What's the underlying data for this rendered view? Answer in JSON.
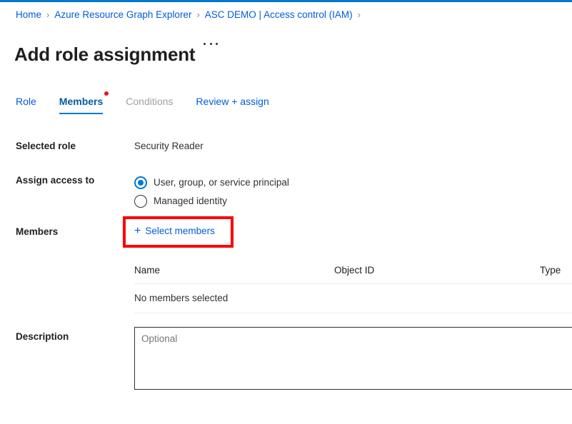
{
  "theme": {
    "accent": "#0078d4",
    "link": "#015cda",
    "highlight_red": "#fe0000",
    "dot_red": "#e81123",
    "disabled_text": "#a19f9d"
  },
  "top_accent_bar": {
    "color": "#0078d4"
  },
  "breadcrumb": {
    "items": [
      {
        "label": "Home"
      },
      {
        "label": "Azure Resource Graph Explorer"
      },
      {
        "label": "ASC DEMO | Access control (IAM)"
      }
    ],
    "separator": "›"
  },
  "header": {
    "title": "Add role assignment",
    "more_menu": "more-commands-ellipsis"
  },
  "tabs": [
    {
      "label": "Role",
      "state": "enabled"
    },
    {
      "label": "Members",
      "state": "active",
      "has_required_dot": true
    },
    {
      "label": "Conditions",
      "state": "disabled"
    },
    {
      "label": "Review + assign",
      "state": "enabled"
    }
  ],
  "form": {
    "selected_role": {
      "label": "Selected role",
      "value": "Security Reader"
    },
    "assign_access_to": {
      "label": "Assign access to",
      "options": [
        {
          "label": "User, group, or service principal",
          "checked": true
        },
        {
          "label": "Managed identity",
          "checked": false
        }
      ]
    },
    "members": {
      "label": "Members",
      "select_button": "Select members",
      "plus_icon": "plus-icon",
      "highlighted": true
    },
    "description": {
      "label": "Description",
      "value": "",
      "placeholder": "Optional"
    }
  },
  "members_table": {
    "columns": [
      "Name",
      "Object ID",
      "Type"
    ],
    "empty_message": "No members selected",
    "rows": []
  }
}
